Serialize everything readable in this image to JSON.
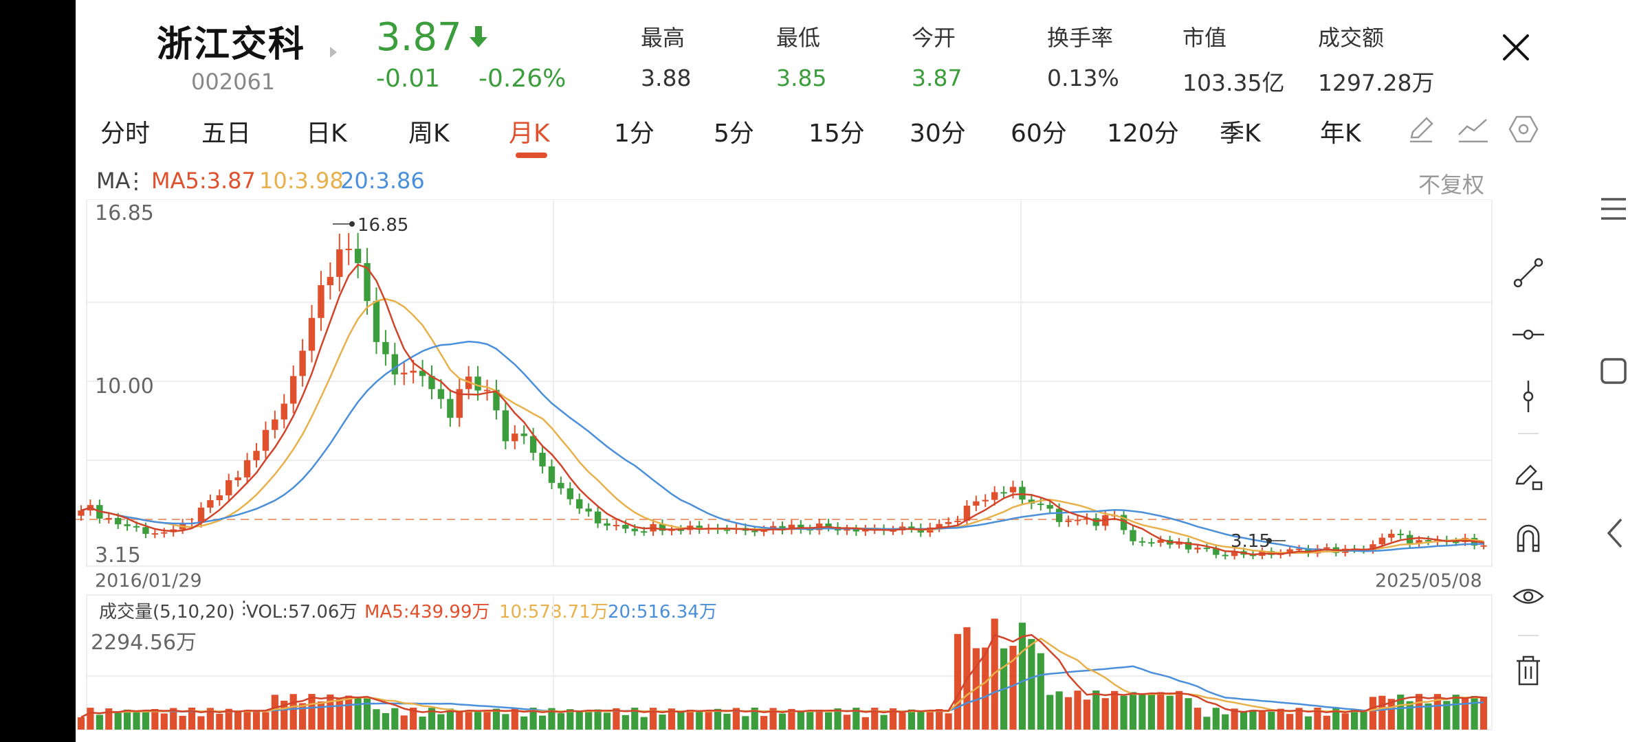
{
  "stock": {
    "name": "浙江交科",
    "code": "002061",
    "price": "3.87",
    "change": "-0.01",
    "change_pct": "-0.26%"
  },
  "stats": [
    {
      "label": "最高",
      "value": "3.88",
      "color": "#333333"
    },
    {
      "label": "最低",
      "value": "3.85",
      "color": "#3c9d3c"
    },
    {
      "label": "今开",
      "value": "3.87",
      "color": "#3c9d3c"
    },
    {
      "label": "换手率",
      "value": "0.13%",
      "color": "#333333"
    },
    {
      "label": "市值",
      "value": "103.35亿",
      "color": "#333333"
    },
    {
      "label": "成交额",
      "value": "1297.28万",
      "color": "#333333"
    }
  ],
  "tabs": [
    "分时",
    "五日",
    "日K",
    "周K",
    "月K",
    "1分",
    "5分",
    "15分",
    "30分",
    "60分",
    "120分",
    "季K",
    "年K"
  ],
  "active_tab": "月K",
  "ma_legend": {
    "label": "MA",
    "ma5": "MA5:3.87",
    "ma10": "10:3.98",
    "ma20": "20:3.86"
  },
  "adjust_label": "不复权",
  "price_axis": {
    "top": "16.85",
    "mid": "10.00",
    "bottom": "3.15"
  },
  "annotations": {
    "high": "16.85",
    "low": "3.15"
  },
  "date_range": {
    "start": "2016/01/29",
    "end": "2025/05/08"
  },
  "volume_legend": {
    "label": "成交量(5,10,20)",
    "vol": "VOL:57.06万",
    "ma5": "MA5:439.99万",
    "ma10": "10:578.71万",
    "ma20": "20:516.34万"
  },
  "volume_axis": {
    "top": "2294.56万"
  },
  "colors": {
    "up": "#e0502d",
    "down": "#3c9d3c",
    "ma5": "#e0502d",
    "ma10": "#e8b04a",
    "ma20": "#4a8fd9",
    "accent": "#e0502d"
  },
  "side_tools": [
    "line-tool-icon",
    "horizontal-line-icon",
    "vertical-line-icon",
    "pen-icon",
    "magnet-icon",
    "eye-icon",
    "trash-icon"
  ],
  "nav_buttons": [
    "menu-icon",
    "square-icon",
    "back-icon"
  ]
}
